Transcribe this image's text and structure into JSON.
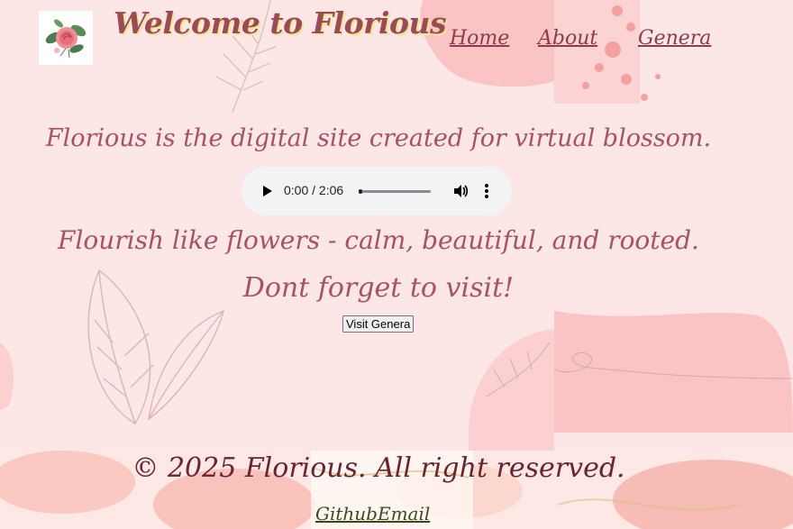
{
  "header": {
    "site_title": "Welcome to Florious",
    "nav": [
      {
        "label": "Home"
      },
      {
        "label": "About"
      },
      {
        "label": "Genera"
      }
    ]
  },
  "main": {
    "intro": "Florious is the digital site created for virtual blossom.",
    "audio": {
      "time": "0:00 / 2:06",
      "progress": 0
    },
    "tagline": "Flourish like flowers - calm, beautiful, and rooted.",
    "reminder": "Dont forget to visit!",
    "visit_button": "Visit Genera"
  },
  "footer": {
    "copyright": "© 2025 Florious. All right reserved.",
    "links": [
      {
        "label": "Github"
      },
      {
        "label": "Email"
      }
    ]
  },
  "colors": {
    "background": "#fde6e6",
    "heading": "#a7535f",
    "title_shadow": "#f1e694",
    "footer_text": "#6b2330",
    "footer_link": "#3b4a1e"
  },
  "icons": [
    "rose-logo-icon",
    "play-icon",
    "volume-icon",
    "more-options-icon"
  ]
}
